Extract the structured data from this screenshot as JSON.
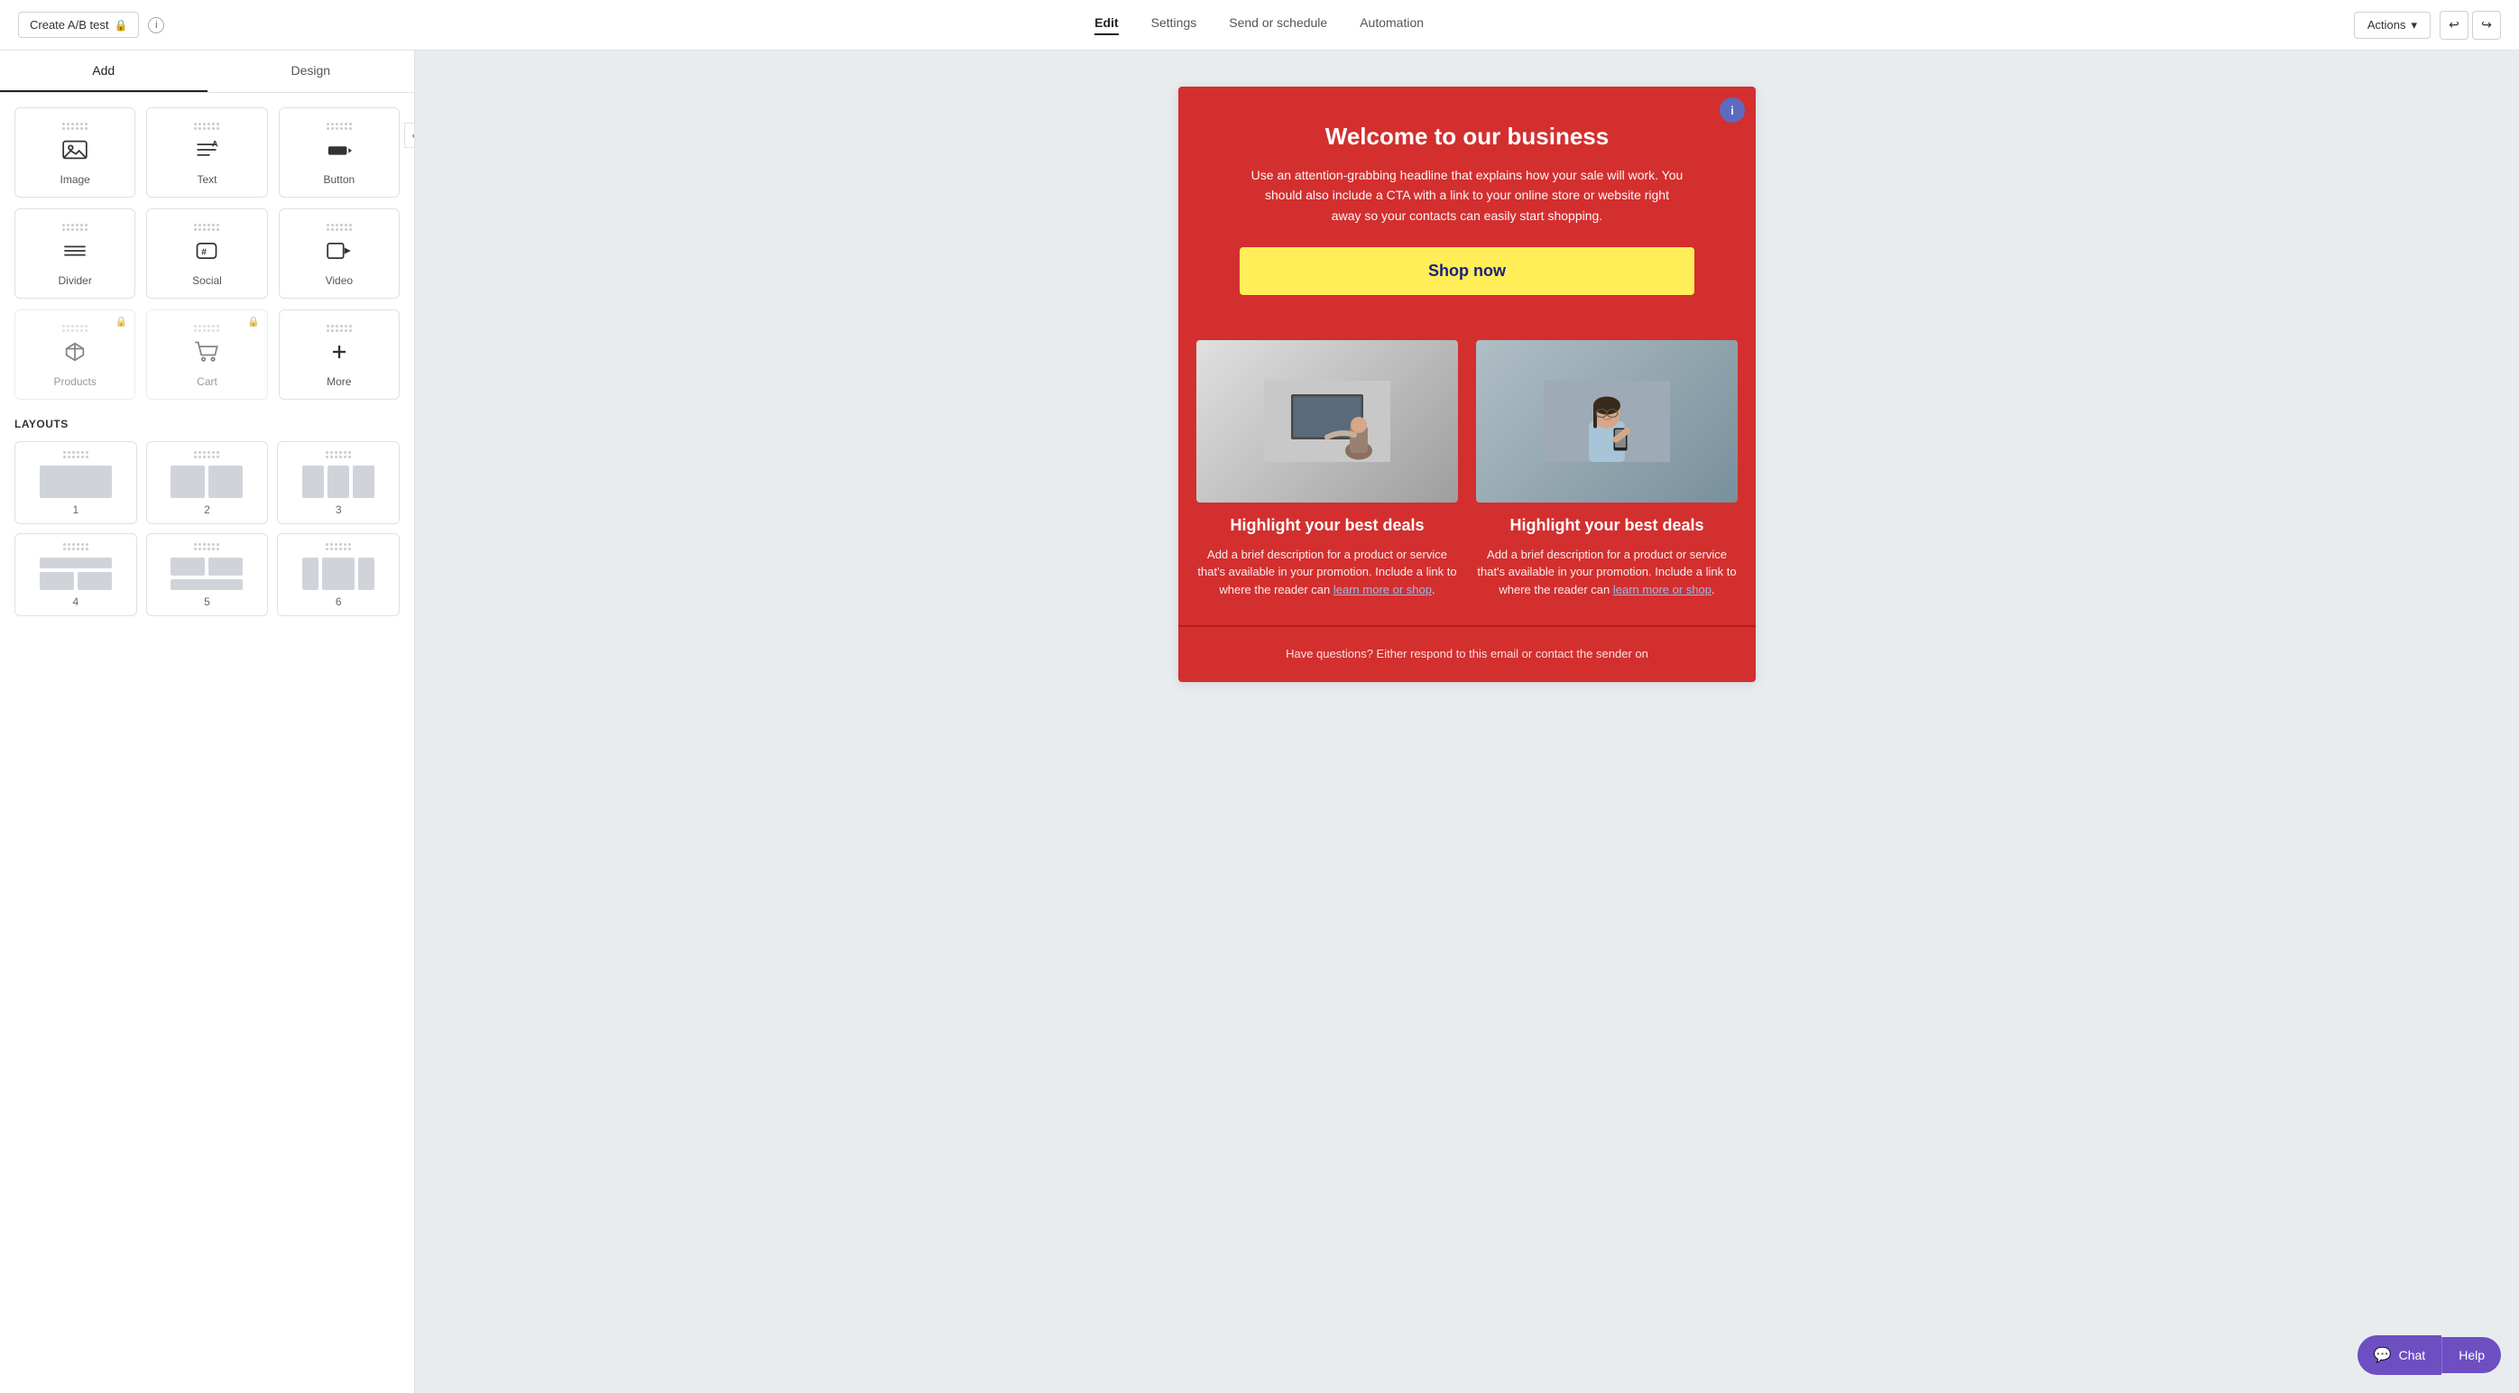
{
  "topNav": {
    "createAbTest": "Create A/B test",
    "tabs": [
      {
        "label": "Edit",
        "active": true
      },
      {
        "label": "Settings",
        "active": false
      },
      {
        "label": "Send or schedule",
        "active": false
      },
      {
        "label": "Automation",
        "active": false
      }
    ],
    "actionsLabel": "Actions",
    "undoIcon": "↩",
    "redoIcon": "↪"
  },
  "sidebar": {
    "tabs": [
      {
        "label": "Add",
        "active": true
      },
      {
        "label": "Design",
        "active": false
      }
    ],
    "addItems": [
      {
        "label": "Image",
        "icon": "🖼",
        "locked": false
      },
      {
        "label": "Text",
        "icon": "≡A",
        "locked": false
      },
      {
        "label": "Button",
        "icon": "⬛▶",
        "locked": false
      },
      {
        "label": "Divider",
        "icon": "≡",
        "locked": false
      },
      {
        "label": "Social",
        "icon": "#💬",
        "locked": false
      },
      {
        "label": "Video",
        "icon": "▶⬛",
        "locked": false
      },
      {
        "label": "Products",
        "icon": "⬡",
        "locked": true
      },
      {
        "label": "Cart",
        "icon": "🛒",
        "locked": true
      },
      {
        "label": "More",
        "icon": "+",
        "locked": false
      }
    ],
    "layoutsTitle": "LAYOUTS",
    "layouts": [
      {
        "label": "1",
        "cols": 1
      },
      {
        "label": "2",
        "cols": 2
      },
      {
        "label": "3",
        "cols": 3
      },
      {
        "label": "4",
        "cols": 2
      },
      {
        "label": "5",
        "cols": 2
      },
      {
        "label": "6",
        "cols": 3
      }
    ]
  },
  "emailPreview": {
    "headerBg": "#d32f2f",
    "title": "Welcome to our business",
    "subtitle": "Use an attention-grabbing headline that explains how your sale will work. You should also include a CTA with a link to your online store or website right away so your contacts can easily start shopping.",
    "shopNowLabel": "Shop now",
    "products": [
      {
        "heading": "Highlight your best deals",
        "description": "Add a brief description for a product or service that's available in your promotion. Include a link to where the reader can",
        "linkText": "learn more or shop",
        "linkAfter": "."
      },
      {
        "heading": "Highlight your best deals",
        "description": "Add a brief description for a product or service that's available in your promotion. Include a link to where the reader can",
        "linkText": "learn more or shop",
        "linkAfter": "."
      }
    ],
    "footerText": "Have questions? Either respond to this email or contact the sender on"
  },
  "chat": {
    "chatLabel": "Chat",
    "helpLabel": "Help"
  }
}
